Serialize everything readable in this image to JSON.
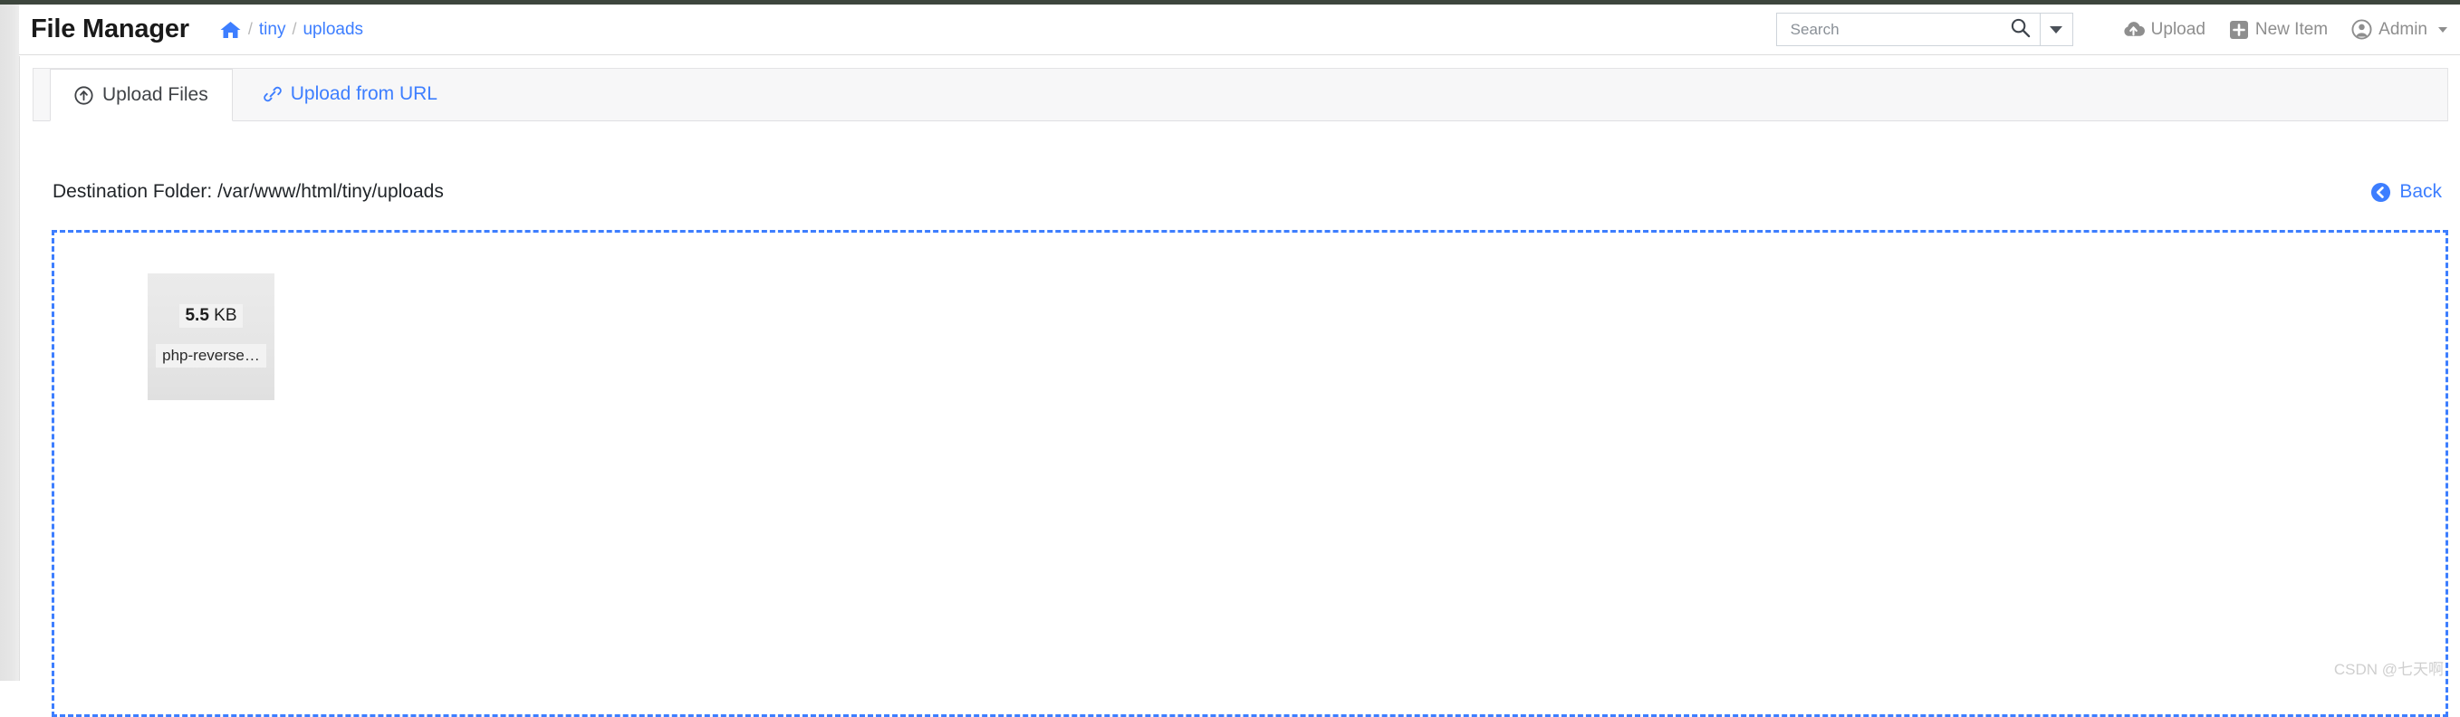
{
  "app": {
    "title": "File Manager"
  },
  "breadcrumb": {
    "home_icon": "home-icon",
    "separator": "/",
    "items": [
      {
        "label": "tiny"
      },
      {
        "label": "uploads"
      }
    ]
  },
  "search": {
    "placeholder": "Search",
    "value": "",
    "icon": "search-icon",
    "caret_icon": "chevron-down-icon"
  },
  "header_actions": [
    {
      "label": "Upload",
      "icon": "cloud-upload-icon"
    },
    {
      "label": "New Item",
      "icon": "plus-square-icon"
    },
    {
      "label": "Admin",
      "icon": "user-circle-icon",
      "caret": true
    }
  ],
  "tabs": [
    {
      "label": "Upload Files",
      "icon": "upload-circle-icon",
      "active": true
    },
    {
      "label": "Upload from URL",
      "icon": "link-icon",
      "active": false
    }
  ],
  "destination": {
    "label": "Destination Folder:",
    "path": "/var/www/html/tiny/uploads",
    "full": "Destination Folder: /var/www/html/tiny/uploads"
  },
  "back": {
    "label": "Back",
    "icon": "chevron-circle-left-icon"
  },
  "dropzone": {
    "files": [
      {
        "size_value": "5.5",
        "size_unit": "KB",
        "size_text": "5.5 KB",
        "name": "php-reverse…"
      }
    ]
  },
  "watermark": {
    "text": "CSDN @七天啊"
  },
  "colors": {
    "accent": "#3d7eff",
    "top_strip": "#3d463d",
    "muted": "#8e8e8e",
    "tab_bar_bg": "#f7f7f8"
  }
}
